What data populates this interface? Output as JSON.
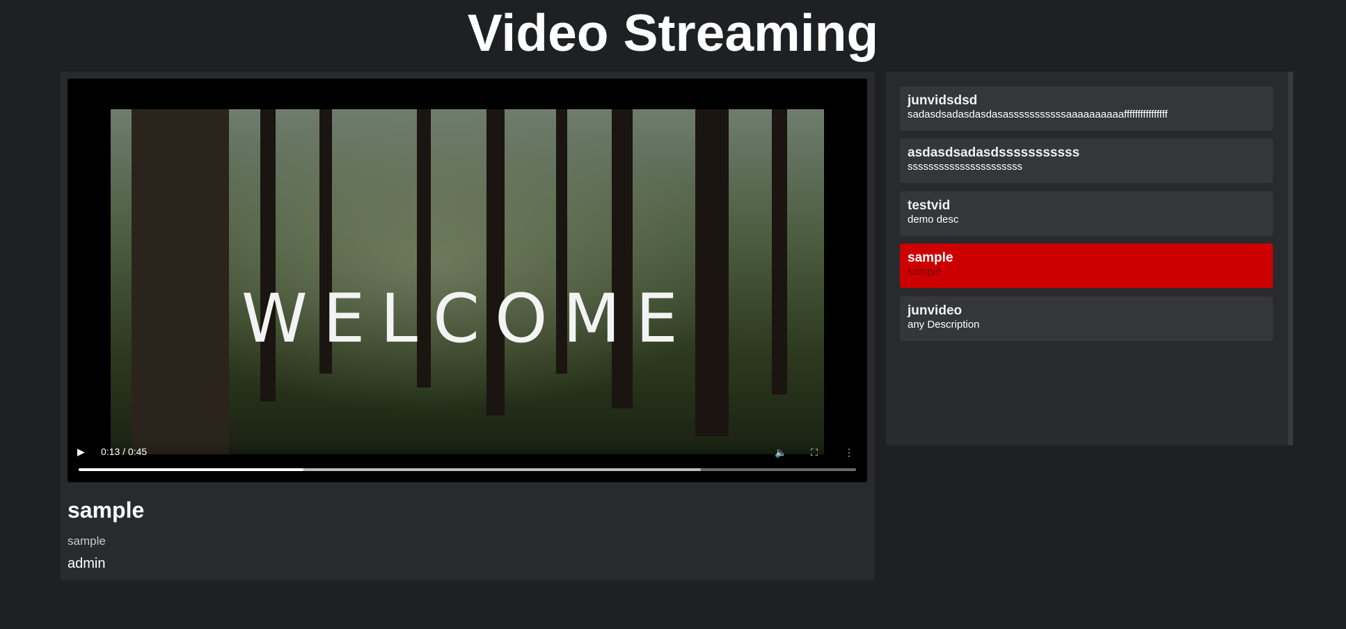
{
  "header": {
    "title": "Video Streaming"
  },
  "player": {
    "overlay_text": "WELCOME",
    "time": "0:13 / 0:45",
    "progress_fraction": 0.289,
    "buffered_fraction": 0.8,
    "icons": [
      "play-icon",
      "volume-icon",
      "fullscreen-icon",
      "more-options-icon"
    ]
  },
  "current_video": {
    "title": "sample",
    "description": "sample",
    "author": "admin"
  },
  "playlist": {
    "active_color": "#cc0000",
    "items": [
      {
        "title": "junvidsdsd",
        "description": "sadasdsadasdasdasasssssssssssaaaaaaaaaaffffffffffffffff",
        "active": false
      },
      {
        "title": "asdasdsadasdsssssssssss",
        "description": "ssssssssssssssssssssss",
        "active": false
      },
      {
        "title": "testvid",
        "description": "demo desc",
        "active": false
      },
      {
        "title": "sample",
        "description": "sample",
        "active": true
      },
      {
        "title": "junvideo",
        "description": "any Description",
        "active": false
      }
    ]
  }
}
